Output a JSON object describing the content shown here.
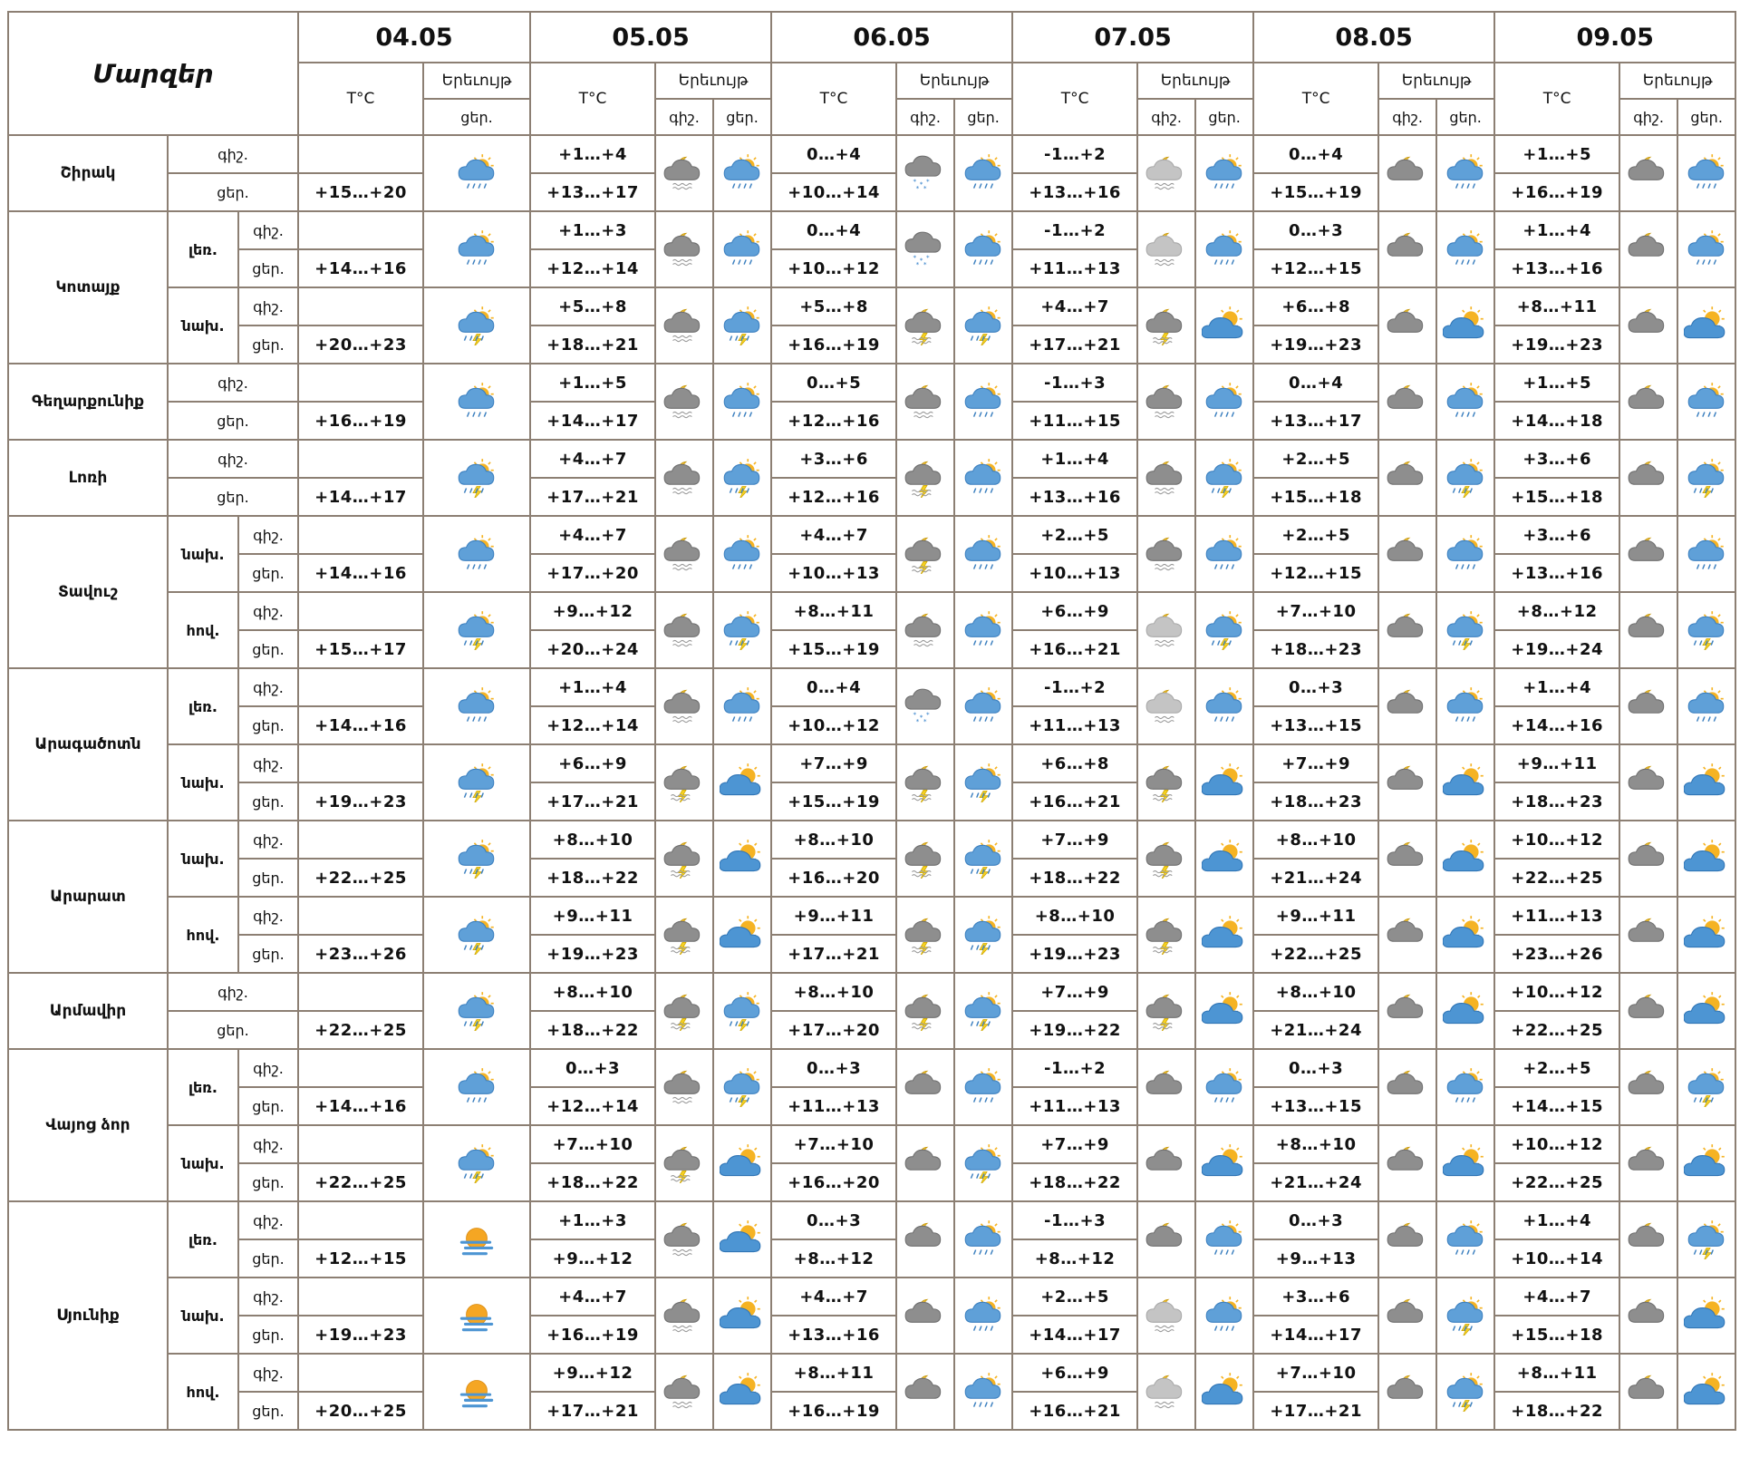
{
  "header": {
    "title": "Մարզեր",
    "temp_label": "T°C",
    "cond_label": "Երեւույթ",
    "night_label": "գիշ.",
    "day_label": "ցեր."
  },
  "days": [
    "04.05",
    "05.05",
    "06.05",
    "07.05",
    "08.05",
    "09.05"
  ],
  "icon_legend": {
    "partly-rain": "sun behind cloud with rain",
    "cloud-moon-rain": "moon behind grey cloud with rain",
    "cloud-snow": "grey cloud with snow",
    "cloud-moon-thunder": "moon behind grey cloud with thunder",
    "cloud-moon": "moon behind grey cloud",
    "sun-cloud": "sun behind blue cloud",
    "partly-thunder": "sun behind cloud with thunder",
    "light-cloud-rain": "light grey cloud with rain",
    "fog-sun": "sun with fog"
  },
  "regions": [
    {
      "name": "Շիրակ",
      "zones": [
        {
          "name": "",
          "night": [
            "",
            "+1…+4",
            "0…+4",
            "-1…+2",
            "0…+4",
            "+1…+5"
          ],
          "day": [
            "+15…+20",
            "+13…+17",
            "+10…+14",
            "+13…+16",
            "+15…+19",
            "+16…+19"
          ],
          "icons": [
            [
              "partly-rain"
            ],
            [
              "cloud-moon-rain",
              "partly-rain"
            ],
            [
              "cloud-snow",
              "partly-rain"
            ],
            [
              "light-cloud-rain",
              "partly-rain"
            ],
            [
              "cloud-moon",
              "partly-rain"
            ],
            [
              "cloud-moon",
              "partly-rain"
            ]
          ]
        }
      ]
    },
    {
      "name": "Կոտայք",
      "zones": [
        {
          "name": "լեռ.",
          "night": [
            "",
            "+1…+3",
            "0…+4",
            "-1…+2",
            "0…+3",
            "+1…+4"
          ],
          "day": [
            "+14…+16",
            "+12…+14",
            "+10…+12",
            "+11…+13",
            "+12…+15",
            "+13…+16"
          ],
          "icons": [
            [
              "partly-rain"
            ],
            [
              "cloud-moon-rain",
              "partly-rain"
            ],
            [
              "cloud-snow",
              "partly-rain"
            ],
            [
              "light-cloud-rain",
              "partly-rain"
            ],
            [
              "cloud-moon",
              "partly-rain"
            ],
            [
              "cloud-moon",
              "partly-rain"
            ]
          ]
        },
        {
          "name": "նախ.",
          "night": [
            "",
            "+5…+8",
            "+5…+8",
            "+4…+7",
            "+6…+8",
            "+8…+11"
          ],
          "day": [
            "+20…+23",
            "+18…+21",
            "+16…+19",
            "+17…+21",
            "+19…+23",
            "+19…+23"
          ],
          "icons": [
            [
              "partly-thunder"
            ],
            [
              "cloud-moon-rain",
              "partly-thunder"
            ],
            [
              "cloud-moon-thunder",
              "partly-thunder"
            ],
            [
              "cloud-moon-thunder",
              "sun-cloud"
            ],
            [
              "cloud-moon",
              "sun-cloud"
            ],
            [
              "cloud-moon",
              "sun-cloud"
            ]
          ]
        }
      ]
    },
    {
      "name": "Գեղարքունիք",
      "zones": [
        {
          "name": "",
          "night": [
            "",
            "+1…+5",
            "0…+5",
            "-1…+3",
            "0…+4",
            "+1…+5"
          ],
          "day": [
            "+16…+19",
            "+14…+17",
            "+12…+16",
            "+11…+15",
            "+13…+17",
            "+14…+18"
          ],
          "icons": [
            [
              "partly-rain"
            ],
            [
              "cloud-moon-rain",
              "partly-rain"
            ],
            [
              "cloud-moon-rain",
              "partly-rain"
            ],
            [
              "cloud-moon-rain",
              "partly-rain"
            ],
            [
              "cloud-moon",
              "partly-rain"
            ],
            [
              "cloud-moon",
              "partly-rain"
            ]
          ]
        }
      ]
    },
    {
      "name": "Լոռի",
      "zones": [
        {
          "name": "",
          "night": [
            "",
            "+4…+7",
            "+3…+6",
            "+1…+4",
            "+2…+5",
            "+3…+6"
          ],
          "day": [
            "+14…+17",
            "+17…+21",
            "+12…+16",
            "+13…+16",
            "+15…+18",
            "+15…+18"
          ],
          "icons": [
            [
              "partly-thunder"
            ],
            [
              "cloud-moon-rain",
              "partly-thunder"
            ],
            [
              "cloud-moon-thunder",
              "partly-rain"
            ],
            [
              "cloud-moon-rain",
              "partly-thunder"
            ],
            [
              "cloud-moon",
              "partly-thunder"
            ],
            [
              "cloud-moon",
              "partly-thunder"
            ]
          ]
        }
      ]
    },
    {
      "name": "Տավուշ",
      "zones": [
        {
          "name": "նախ.",
          "night": [
            "",
            "+4…+7",
            "+4…+7",
            "+2…+5",
            "+2…+5",
            "+3…+6"
          ],
          "day": [
            "+14…+16",
            "+17…+20",
            "+10…+13",
            "+10…+13",
            "+12…+15",
            "+13…+16"
          ],
          "icons": [
            [
              "partly-rain"
            ],
            [
              "cloud-moon-rain",
              "partly-rain"
            ],
            [
              "cloud-moon-thunder",
              "partly-rain"
            ],
            [
              "cloud-moon-rain",
              "partly-rain"
            ],
            [
              "cloud-moon",
              "partly-rain"
            ],
            [
              "cloud-moon",
              "partly-rain"
            ]
          ]
        },
        {
          "name": "հով.",
          "night": [
            "",
            "+9…+12",
            "+8…+11",
            "+6…+9",
            "+7…+10",
            "+8…+12"
          ],
          "day": [
            "+15…+17",
            "+20…+24",
            "+15…+19",
            "+16…+21",
            "+18…+23",
            "+19…+24"
          ],
          "icons": [
            [
              "partly-thunder"
            ],
            [
              "cloud-moon-rain",
              "partly-thunder"
            ],
            [
              "cloud-moon-rain",
              "partly-rain"
            ],
            [
              "light-cloud-rain",
              "partly-thunder"
            ],
            [
              "cloud-moon",
              "partly-thunder"
            ],
            [
              "cloud-moon",
              "partly-thunder"
            ]
          ]
        }
      ]
    },
    {
      "name": "Արագածոտն",
      "zones": [
        {
          "name": "լեռ.",
          "night": [
            "",
            "+1…+4",
            "0…+4",
            "-1…+2",
            "0…+3",
            "+1…+4"
          ],
          "day": [
            "+14…+16",
            "+12…+14",
            "+10…+12",
            "+11…+13",
            "+13…+15",
            "+14…+16"
          ],
          "icons": [
            [
              "partly-rain"
            ],
            [
              "cloud-moon-rain",
              "partly-rain"
            ],
            [
              "cloud-snow",
              "partly-rain"
            ],
            [
              "light-cloud-rain",
              "partly-rain"
            ],
            [
              "cloud-moon",
              "partly-rain"
            ],
            [
              "cloud-moon",
              "partly-rain"
            ]
          ]
        },
        {
          "name": "նախ.",
          "night": [
            "",
            "+6…+9",
            "+7…+9",
            "+6…+8",
            "+7…+9",
            "+9…+11"
          ],
          "day": [
            "+19…+23",
            "+17…+21",
            "+15…+19",
            "+16…+21",
            "+18…+23",
            "+18…+23"
          ],
          "icons": [
            [
              "partly-thunder"
            ],
            [
              "cloud-moon-thunder",
              "sun-cloud"
            ],
            [
              "cloud-moon-thunder",
              "partly-thunder"
            ],
            [
              "cloud-moon-thunder",
              "sun-cloud"
            ],
            [
              "cloud-moon",
              "sun-cloud"
            ],
            [
              "cloud-moon",
              "sun-cloud"
            ]
          ]
        }
      ]
    },
    {
      "name": "Արարատ",
      "zones": [
        {
          "name": "նախ.",
          "night": [
            "",
            "+8…+10",
            "+8…+10",
            "+7…+9",
            "+8…+10",
            "+10…+12"
          ],
          "day": [
            "+22…+25",
            "+18…+22",
            "+16…+20",
            "+18…+22",
            "+21…+24",
            "+22…+25"
          ],
          "icons": [
            [
              "partly-thunder"
            ],
            [
              "cloud-moon-thunder",
              "sun-cloud"
            ],
            [
              "cloud-moon-thunder",
              "partly-thunder"
            ],
            [
              "cloud-moon-thunder",
              "sun-cloud"
            ],
            [
              "cloud-moon",
              "sun-cloud"
            ],
            [
              "cloud-moon",
              "sun-cloud"
            ]
          ]
        },
        {
          "name": "հով.",
          "night": [
            "",
            "+9…+11",
            "+9…+11",
            "+8…+10",
            "+9…+11",
            "+11…+13"
          ],
          "day": [
            "+23…+26",
            "+19…+23",
            "+17…+21",
            "+19…+23",
            "+22…+25",
            "+23…+26"
          ],
          "icons": [
            [
              "partly-thunder"
            ],
            [
              "cloud-moon-thunder",
              "sun-cloud"
            ],
            [
              "cloud-moon-thunder",
              "partly-thunder"
            ],
            [
              "cloud-moon-thunder",
              "sun-cloud"
            ],
            [
              "cloud-moon",
              "sun-cloud"
            ],
            [
              "cloud-moon",
              "sun-cloud"
            ]
          ]
        }
      ]
    },
    {
      "name": "Արմավիր",
      "zones": [
        {
          "name": "",
          "night": [
            "",
            "+8…+10",
            "+8…+10",
            "+7…+9",
            "+8…+10",
            "+10…+12"
          ],
          "day": [
            "+22…+25",
            "+18…+22",
            "+17…+20",
            "+19…+22",
            "+21…+24",
            "+22…+25"
          ],
          "icons": [
            [
              "partly-thunder"
            ],
            [
              "cloud-moon-thunder",
              "partly-thunder"
            ],
            [
              "cloud-moon-thunder",
              "partly-thunder"
            ],
            [
              "cloud-moon-thunder",
              "sun-cloud"
            ],
            [
              "cloud-moon",
              "sun-cloud"
            ],
            [
              "cloud-moon",
              "sun-cloud"
            ]
          ]
        }
      ]
    },
    {
      "name": "Վայոց ձոր",
      "zones": [
        {
          "name": "լեռ.",
          "night": [
            "",
            "0…+3",
            "0…+3",
            "-1…+2",
            "0…+3",
            "+2…+5"
          ],
          "day": [
            "+14…+16",
            "+12…+14",
            "+11…+13",
            "+11…+13",
            "+13…+15",
            "+14…+15"
          ],
          "icons": [
            [
              "partly-rain"
            ],
            [
              "cloud-moon-rain",
              "partly-thunder"
            ],
            [
              "cloud-moon",
              "partly-rain"
            ],
            [
              "cloud-moon",
              "partly-rain"
            ],
            [
              "cloud-moon",
              "partly-rain"
            ],
            [
              "cloud-moon",
              "partly-thunder"
            ]
          ]
        },
        {
          "name": "նախ.",
          "night": [
            "",
            "+7…+10",
            "+7…+10",
            "+7…+9",
            "+8…+10",
            "+10…+12"
          ],
          "day": [
            "+22…+25",
            "+18…+22",
            "+16…+20",
            "+18…+22",
            "+21…+24",
            "+22…+25"
          ],
          "icons": [
            [
              "partly-thunder"
            ],
            [
              "cloud-moon-thunder",
              "sun-cloud"
            ],
            [
              "cloud-moon",
              "partly-thunder"
            ],
            [
              "cloud-moon",
              "sun-cloud"
            ],
            [
              "cloud-moon",
              "sun-cloud"
            ],
            [
              "cloud-moon",
              "sun-cloud"
            ]
          ]
        }
      ]
    },
    {
      "name": "Սյունիք",
      "zones": [
        {
          "name": "լեռ.",
          "night": [
            "",
            "+1…+3",
            "0…+3",
            "-1…+3",
            "0…+3",
            "+1…+4"
          ],
          "day": [
            "+12…+15",
            "+9…+12",
            "+8…+12",
            "+8…+12",
            "+9…+13",
            "+10…+14"
          ],
          "icons": [
            [
              "fog-sun"
            ],
            [
              "cloud-moon-rain",
              "sun-cloud"
            ],
            [
              "cloud-moon",
              "partly-rain"
            ],
            [
              "cloud-moon",
              "partly-rain"
            ],
            [
              "cloud-moon",
              "partly-rain"
            ],
            [
              "cloud-moon",
              "partly-thunder"
            ]
          ]
        },
        {
          "name": "նախ.",
          "night": [
            "",
            "+4…+7",
            "+4…+7",
            "+2…+5",
            "+3…+6",
            "+4…+7"
          ],
          "day": [
            "+19…+23",
            "+16…+19",
            "+13…+16",
            "+14…+17",
            "+14…+17",
            "+15…+18"
          ],
          "icons": [
            [
              "fog-sun"
            ],
            [
              "cloud-moon-rain",
              "sun-cloud"
            ],
            [
              "cloud-moon",
              "partly-rain"
            ],
            [
              "light-cloud-rain",
              "partly-rain"
            ],
            [
              "cloud-moon",
              "partly-thunder"
            ],
            [
              "cloud-moon",
              "sun-cloud"
            ]
          ]
        },
        {
          "name": "հով.",
          "night": [
            "",
            "+9…+12",
            "+8…+11",
            "+6…+9",
            "+7…+10",
            "+8…+11"
          ],
          "day": [
            "+20…+25",
            "+17…+21",
            "+16…+19",
            "+16…+21",
            "+17…+21",
            "+18…+22"
          ],
          "icons": [
            [
              "fog-sun"
            ],
            [
              "cloud-moon-rain",
              "sun-cloud"
            ],
            [
              "cloud-moon",
              "partly-rain"
            ],
            [
              "light-cloud-rain",
              "sun-cloud"
            ],
            [
              "cloud-moon",
              "partly-thunder"
            ],
            [
              "cloud-moon",
              "sun-cloud"
            ]
          ]
        }
      ]
    }
  ]
}
